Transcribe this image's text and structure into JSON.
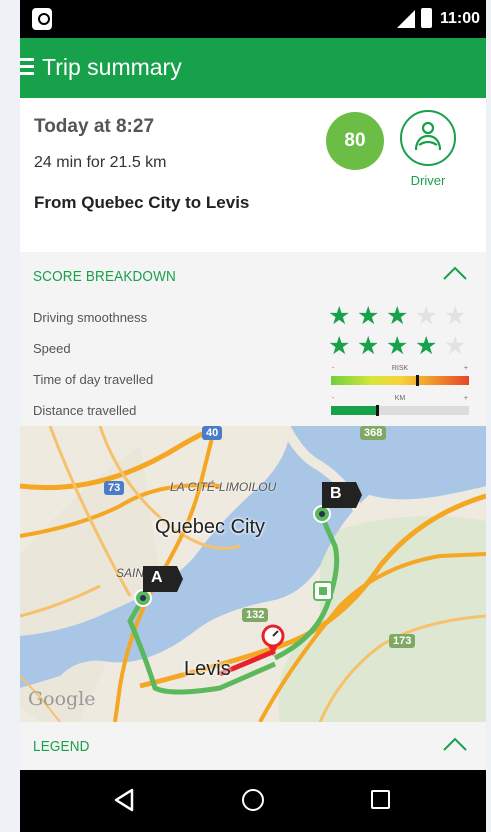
{
  "status_bar": {
    "time": "11:00",
    "app_icon": "location-pin-icon"
  },
  "app_bar": {
    "title": "Trip summary",
    "menu_icon": "hamburger-menu-icon"
  },
  "summary": {
    "time": "Today at 8:27",
    "duration": "24 min for 21.5 km",
    "route": "From Quebec City to Levis",
    "score": "80",
    "driver_label": "Driver",
    "driver_icon": "steering-driver-icon"
  },
  "score_breakdown": {
    "title": "SCORE BREAKDOWN",
    "rows": [
      {
        "label": "Driving smoothness",
        "stars": 3,
        "max_stars": 5
      },
      {
        "label": "Speed",
        "stars": 4,
        "max_stars": 5
      },
      {
        "label": "Time of day travelled",
        "bar_name": "RISK",
        "min": "-",
        "max": "+",
        "level": 0.62
      },
      {
        "label": "Distance travelled",
        "bar_name": "KM",
        "min": "-",
        "max": "+",
        "level": 0.33
      }
    ]
  },
  "map": {
    "city_1": "Quebec City",
    "city_2": "Levis",
    "area_1": "LA CITÉ-LIMOILOU",
    "area_2": "SAINT",
    "marker_a": "A",
    "marker_b": "B",
    "highway_1": "40",
    "highway_2": "73",
    "highway_3": "368",
    "highway_4": "132",
    "highway_5": "173",
    "attribution": "Google",
    "colors": {
      "water": "#a9c6e6",
      "route_good": "#5cb85c",
      "route_bad": "#e8222a",
      "road": "#f5a623"
    }
  },
  "legend": {
    "title": "LEGEND"
  },
  "nav": {
    "back_icon": "back-triangle-icon",
    "home_icon": "home-circle-icon",
    "recents_icon": "recents-square-icon"
  }
}
